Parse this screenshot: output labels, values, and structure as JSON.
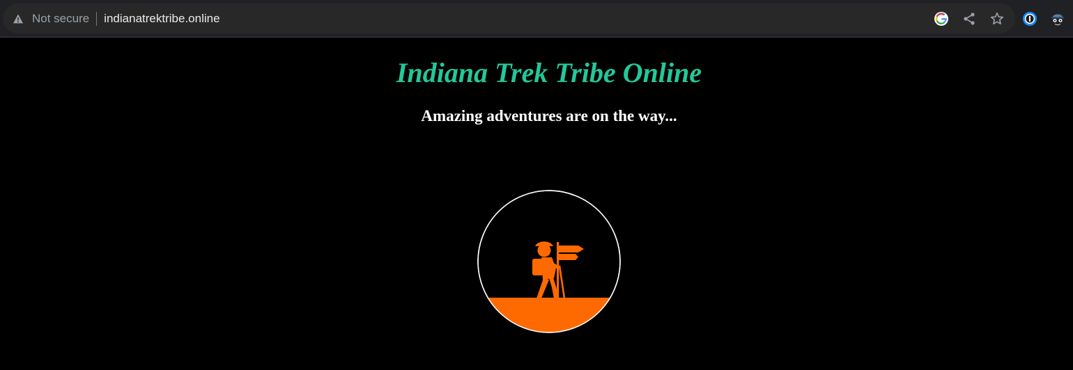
{
  "browser": {
    "security_label": "Not secure",
    "url": "indianatrektribe.online",
    "icons": {
      "security": "warning-triangle-icon",
      "google": "google-icon",
      "share": "share-icon",
      "bookmark": "star-icon",
      "password_manager": "onepassword-icon",
      "extension": "spy-glasses-icon"
    }
  },
  "page": {
    "title": "Indiana Trek Tribe Online",
    "tagline": "Amazing adventures are on the way...",
    "logo": "hiker-signpost-logo"
  },
  "colors": {
    "title": "#23c89a",
    "logo_orange": "#ff6a00",
    "background": "#000000"
  }
}
